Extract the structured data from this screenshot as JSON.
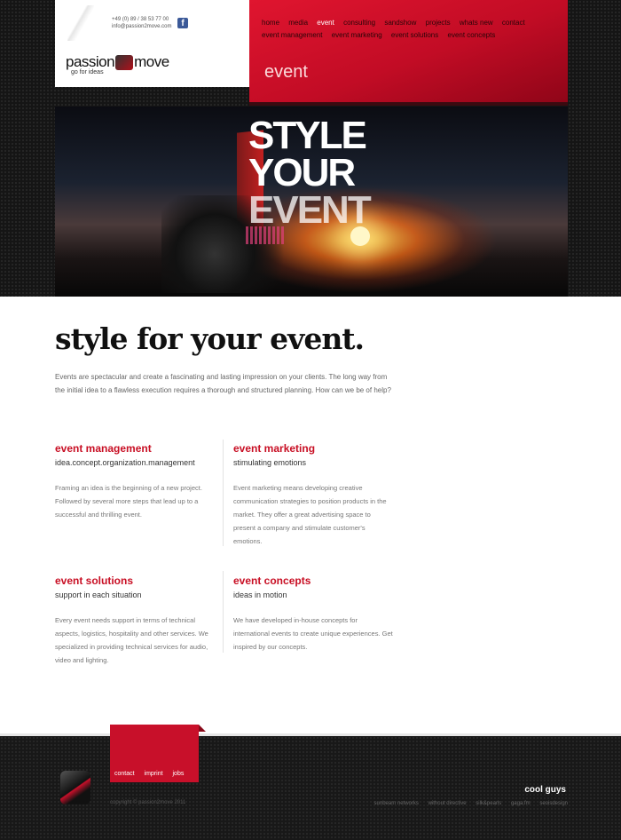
{
  "header": {
    "phone": "+49 (0) 89 / 38 53 77 00",
    "email": "info@passion2move.com",
    "logo_left": "passion",
    "logo_right": "move",
    "tagline": "go for ideas",
    "page_title": "event"
  },
  "nav": {
    "items": [
      "home",
      "media",
      "event",
      "consulting",
      "sandshow",
      "projects",
      "whats new",
      "contact"
    ],
    "subitems": [
      "event management",
      "event marketing",
      "event solutions",
      "event concepts"
    ],
    "active": "event"
  },
  "hero": {
    "line1": "STYLE",
    "line2": "YOUR",
    "line3": "EVENT"
  },
  "main": {
    "heading": "style for your event.",
    "intro": "Events are spectacular and create a fascinating and lasting impression on your clients. The long way from the initial idea to a flawless execution requires a thorough and structured planning. How can we be of help?",
    "sections": [
      {
        "title": "event management",
        "subtitle": "idea.concept.organization.management",
        "text": "Framing an idea is the beginning of a new project. Followed by several more steps that lead up to a successful and thrilling event."
      },
      {
        "title": "event marketing",
        "subtitle": "stimulating emotions",
        "text": "Event marketing means developing creative communication strategies to position products in the market. They offer a great advertising space to present a company and stimulate customer's emotions."
      },
      {
        "title": "event solutions",
        "subtitle": "support in each situation",
        "text": "Every event needs support in terms of technical aspects, logistics, hospitality and other services. We specialized in providing technical services for audio, video and lighting."
      },
      {
        "title": "event concepts",
        "subtitle": "ideas in motion",
        "text": "We have developed in-house concepts for international events to create unique experiences. Get inspired by our concepts."
      }
    ]
  },
  "footer": {
    "links": [
      "contact",
      "imprint",
      "jobs"
    ],
    "copyright": "copyright © passion2move 2011",
    "cool_guys": "cool guys",
    "partners": [
      "sunbeam networks",
      "without directive",
      "silk&pearls",
      "gaga.fm",
      "seoisdesign"
    ]
  },
  "colors": {
    "accent": "#c8102a",
    "dark": "#151515"
  }
}
